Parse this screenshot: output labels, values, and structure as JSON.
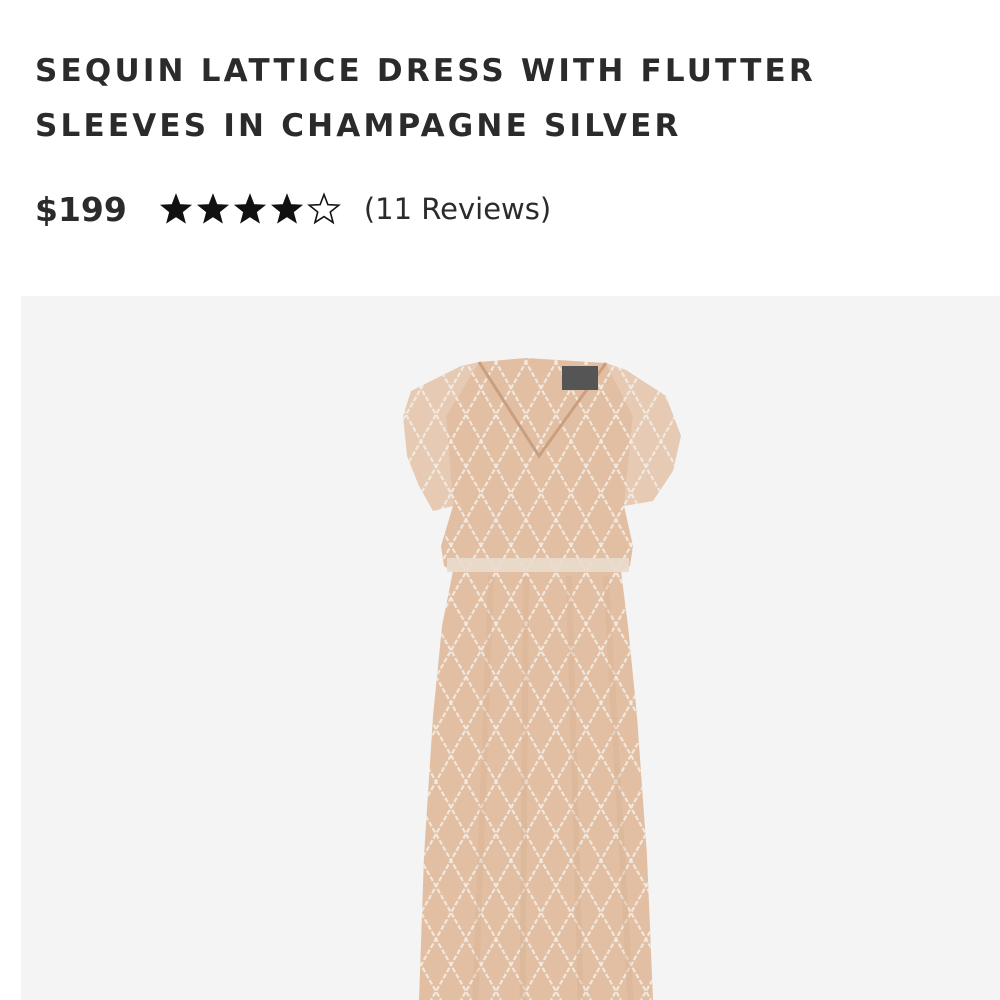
{
  "product": {
    "title_lines": [
      "SEQUIN LATTICE DRESS WITH FLUTTER",
      "SLEEVES IN CHAMPAGNE SILVER"
    ],
    "price": "$199",
    "rating": 4,
    "rating_max": 5,
    "reviews_label": "(11 Reviews)"
  },
  "image": {
    "subject": "dress-image",
    "dress_color": "#e2bfa3",
    "dress_shade": "#d6ae90",
    "sequin_color": "#f3eee8",
    "panel_color": "#f4f4f4"
  },
  "icons": {
    "star_filled": "star-filled-icon",
    "star_empty": "star-empty-icon"
  }
}
